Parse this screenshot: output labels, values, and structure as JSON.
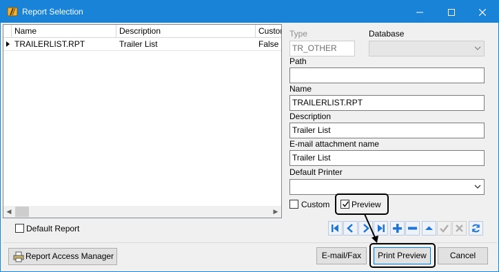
{
  "window": {
    "title": "Report Selection",
    "controls": {
      "minimize": "—",
      "maximize": "☐",
      "close": "✕"
    }
  },
  "grid": {
    "columns": [
      "Name",
      "Description",
      "Custor"
    ],
    "rows": [
      {
        "name": "TRAILERLIST.RPT",
        "description": "Trailer List",
        "custom": "False"
      }
    ]
  },
  "form": {
    "type_label": "Type",
    "type_value": "TR_OTHER",
    "database_label": "Database",
    "database_value": "",
    "path_label": "Path",
    "path_value": "",
    "name_label": "Name",
    "name_value": "TRAILERLIST.RPT",
    "description_label": "Description",
    "description_value": "Trailer List",
    "email_attachment_label": "E-mail attachment name",
    "email_attachment_value": "Trailer List",
    "default_printer_label": "Default Printer",
    "default_printer_value": "",
    "custom_label": "Custom",
    "custom_checked": false,
    "preview_label": "Preview",
    "preview_checked": true
  },
  "default_report": {
    "label": "Default Report",
    "checked": false
  },
  "nav_toolbar": {
    "icons": [
      "first-icon",
      "prev-icon",
      "next-icon",
      "last-icon",
      "add-icon",
      "delete-icon",
      "edit-icon",
      "post-icon",
      "cancel-edit-icon",
      "refresh-icon"
    ]
  },
  "buttons": {
    "report_access_manager": "Report Access Manager",
    "email_fax": "E-mail/Fax",
    "print_preview": "Print Preview",
    "cancel": "Cancel"
  },
  "colors": {
    "title_bar": "#1883d7",
    "nav_blue": "#1e74d8",
    "annotation": "#000000"
  }
}
